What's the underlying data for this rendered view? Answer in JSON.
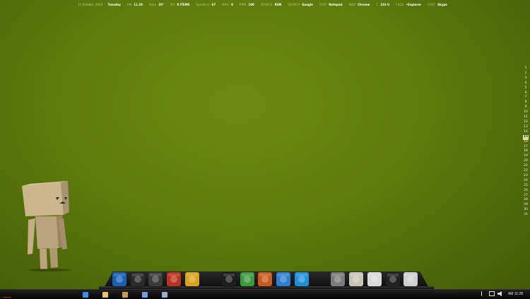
{
  "status_bar": {
    "date": "11 October, 2012",
    "weekday": "Tuesday",
    "ampm": "AM",
    "time": "11.28",
    "haze_label": "Haze",
    "haze_value": "20°",
    "ie_label": "IE9",
    "ie_value": "0 ITEMS",
    "speakers_label": "Speakers",
    "speakers_value": "67",
    "mail_label": "MAIL",
    "mail_value": "0",
    "pwr_label": "PWR",
    "pwr_value": "100",
    "search1_label": "SEARCH",
    "search1_value": "RUN",
    "search2_label": "SEARCH",
    "search2_value": "Google",
    "text_label": "TEXT",
    "text_value": "Notepad",
    "web_label": "WEB",
    "web_value": "Chrome",
    "drive_label": "C",
    "drive_value": "233 G",
    "files_label": "FILES",
    "files_value": "•Explorer",
    "chat_label": "CHAT",
    "chat_value": "Skype"
  },
  "calendar": {
    "days": [
      "1",
      "2",
      "3",
      "4",
      "5",
      "6",
      "7",
      "8",
      "9",
      "10",
      "11",
      "12",
      "13",
      "14",
      "15",
      "16",
      "17",
      "18",
      "19",
      "20",
      "21",
      "22",
      "23",
      "24",
      "25",
      "26",
      "27",
      "28",
      "29",
      "30",
      "31"
    ],
    "today": "15"
  },
  "dock": {
    "icons": [
      {
        "name": "monitor-icon",
        "color": "#1a5fb4"
      },
      {
        "name": "media-player-icon",
        "color": "#2b2b2b"
      },
      {
        "name": "speaker-icon",
        "color": "#3a3a3a"
      },
      {
        "name": "gallery-icon",
        "color": "#b8321e"
      },
      {
        "name": "gold-emblem-icon",
        "color": "#d8a316"
      },
      {
        "name": "dark-bird-icon",
        "color": "#1e1e1e"
      },
      {
        "name": "chrome-icon",
        "color": "#3c9a3c"
      },
      {
        "name": "orange-speaker-icon",
        "color": "#c85a1a"
      },
      {
        "name": "blue-panel-icon",
        "color": "#2d7fd0"
      },
      {
        "name": "skype-icon",
        "color": "#1f8fd8"
      },
      {
        "name": "hazard-box-icon",
        "color": "#7a7a7a"
      },
      {
        "name": "recycle-bin-icon",
        "color": "#c9c4b4"
      },
      {
        "name": "settings-gear-icon",
        "color": "#d9d9d9"
      },
      {
        "name": "scissors-tool-icon",
        "color": "#222222"
      },
      {
        "name": "control-panel-icon",
        "color": "#cfcfcf"
      }
    ]
  },
  "taskbar": {
    "buttons": [
      {
        "name": "ie-taskbar-button",
        "color": "#3a8fe0"
      },
      {
        "name": "explorer-taskbar-button",
        "color": "#e8c660"
      },
      {
        "name": "media-taskbar-button",
        "color": "#c8a040"
      },
      {
        "name": "network-taskbar-button",
        "color": "#6aa0e0"
      },
      {
        "name": "display-taskbar-button",
        "color": "#9ab0c8"
      }
    ],
    "clock": "AM 11:28"
  }
}
